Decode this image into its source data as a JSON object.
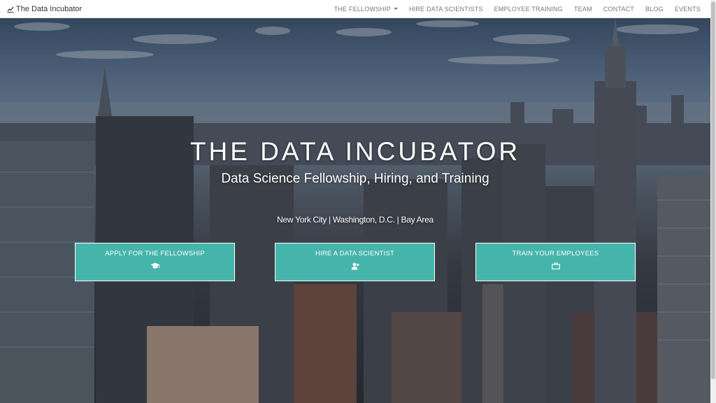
{
  "brand": {
    "name": "The Data Incubator",
    "icon": "chart-line-icon"
  },
  "nav": {
    "items": [
      {
        "label": "THE FELLOWSHIP",
        "has_dropdown": true
      },
      {
        "label": "HIRE DATA SCIENTISTS"
      },
      {
        "label": "EMPLOYEE TRAINING"
      },
      {
        "label": "TEAM"
      },
      {
        "label": "CONTACT"
      },
      {
        "label": "BLOG"
      },
      {
        "label": "EVENTS"
      }
    ]
  },
  "hero": {
    "title": "THE DATA INCUBATOR",
    "subtitle": "Data Science Fellowship, Hiring, and Training",
    "locations": "New York City | Washington, D.C. | Bay Area",
    "background": "new-york-city-skyline-photo"
  },
  "cta": [
    {
      "label": "APPLY FOR THE FELLOWSHIP",
      "icon": "graduation-cap-icon"
    },
    {
      "label": "HIRE A DATA SCIENTIST",
      "icon": "user-plus-icon"
    },
    {
      "label": "TRAIN YOUR EMPLOYEES",
      "icon": "briefcase-icon"
    }
  ],
  "colors": {
    "accent": "#45b5ab",
    "navbar_bg": "#ffffff",
    "nav_text": "#777777"
  }
}
